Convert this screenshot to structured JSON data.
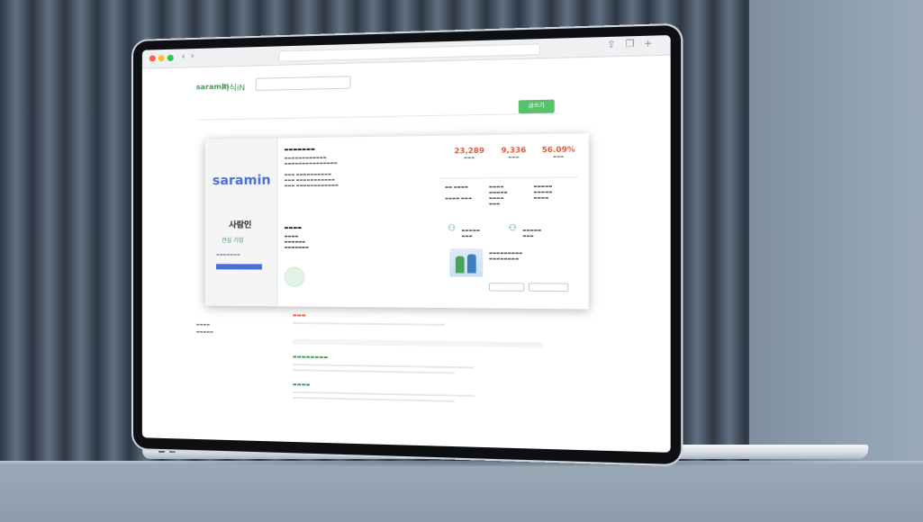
{
  "scene": {
    "wall_color": "#3f4a58",
    "laptop_color": "#dfe4e9"
  },
  "browser": {
    "back_label": "‹",
    "forward_label": "›"
  },
  "site": {
    "logo_text": "saramin",
    "logo_sub": "지식iN",
    "write_button": "글쓰기"
  },
  "company": {
    "logo_text": "saramin",
    "name": "사람인",
    "follow_label": "관심 기업"
  },
  "stats": [
    {
      "value": "23,289",
      "color": "#e05a3a"
    },
    {
      "value": "9,336",
      "color": "#e05a3a"
    },
    {
      "value": "56.09%",
      "color": "#e05a3a"
    }
  ],
  "colors": {
    "brand_blue": "#4a6fd8",
    "brand_green": "#57c26a",
    "accent_red": "#e05a3a"
  }
}
